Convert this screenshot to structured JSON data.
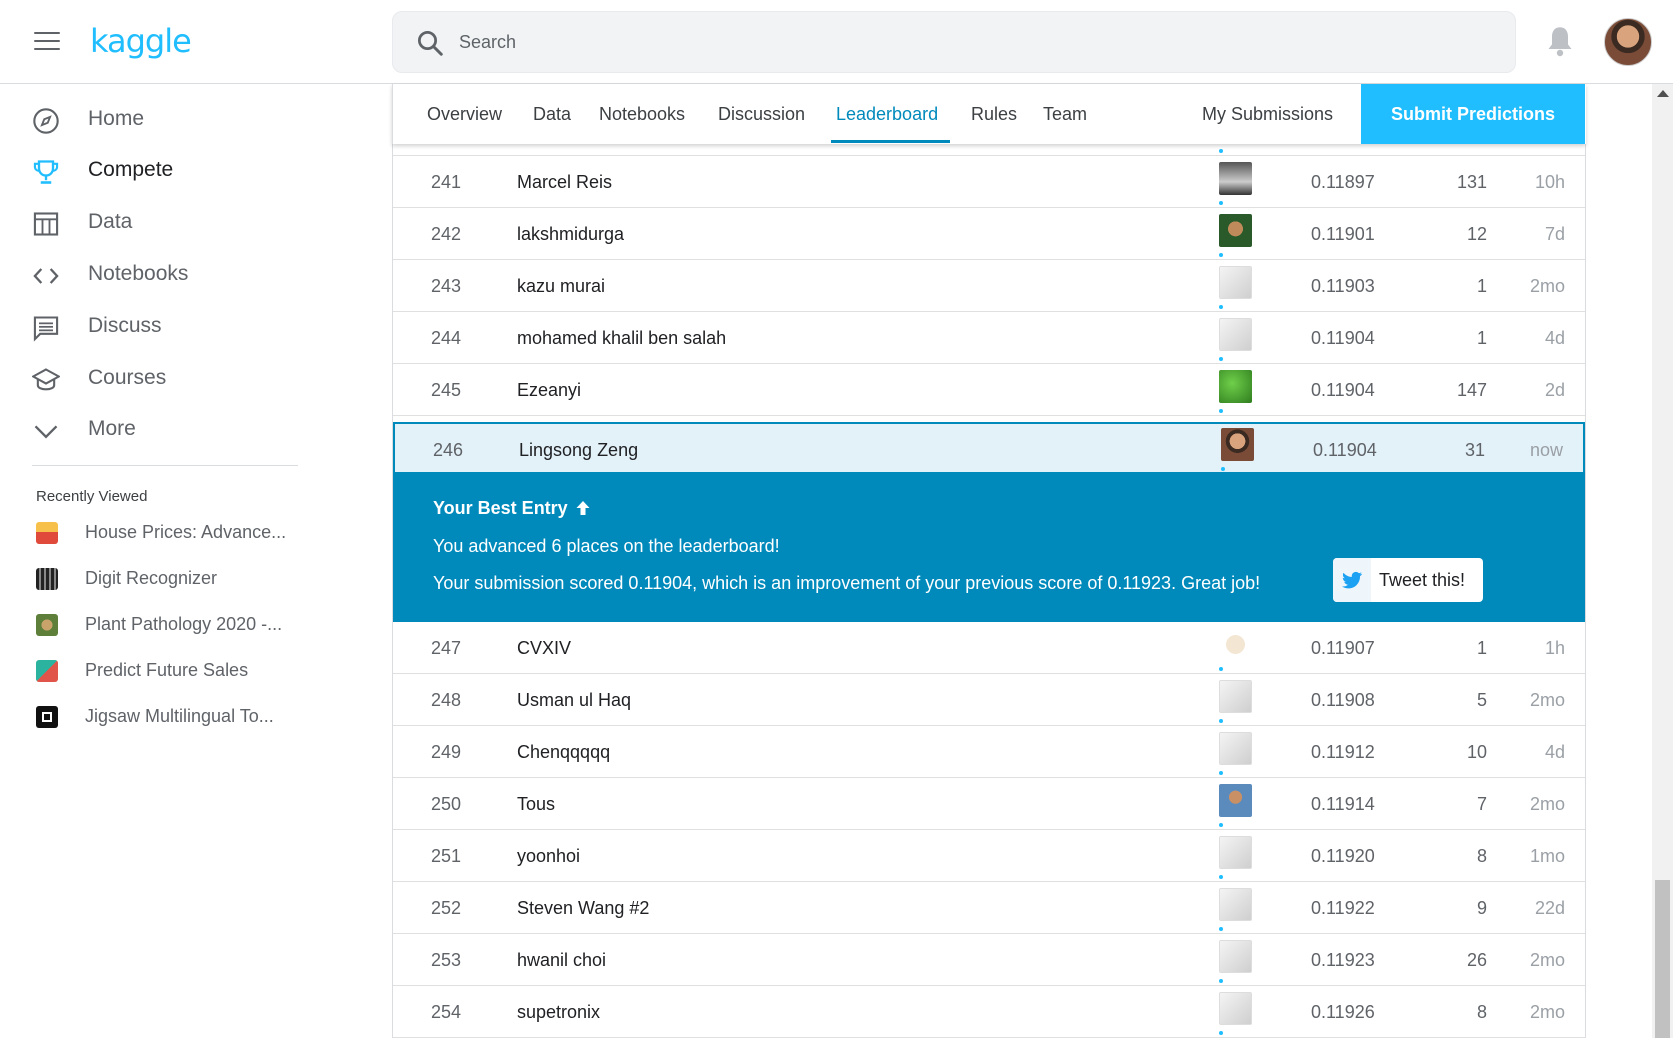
{
  "header": {
    "logo": "kaggle",
    "search_placeholder": "Search"
  },
  "sidebar": {
    "items": [
      {
        "label": "Home",
        "icon": "compass-icon"
      },
      {
        "label": "Compete",
        "icon": "trophy-icon",
        "active": true
      },
      {
        "label": "Data",
        "icon": "table-icon"
      },
      {
        "label": "Notebooks",
        "icon": "code-icon"
      },
      {
        "label": "Discuss",
        "icon": "comment-icon"
      },
      {
        "label": "Courses",
        "icon": "school-icon"
      },
      {
        "label": "More",
        "icon": "chevron-down-icon"
      }
    ],
    "recently_viewed_title": "Recently Viewed",
    "recently_viewed": [
      {
        "label": "House Prices: Advance..."
      },
      {
        "label": "Digit Recognizer"
      },
      {
        "label": "Plant Pathology 2020 -..."
      },
      {
        "label": "Predict Future Sales"
      },
      {
        "label": "Jigsaw Multilingual To..."
      }
    ]
  },
  "tabs": {
    "items": [
      "Overview",
      "Data",
      "Notebooks",
      "Discussion",
      "Leaderboard",
      "Rules",
      "Team"
    ],
    "active": "Leaderboard",
    "my_submissions": "My Submissions",
    "submit": "Submit Predictions"
  },
  "leaderboard": {
    "rows_top": [
      {
        "rank": "241",
        "name": "Marcel Reis",
        "score": "0.11897",
        "entries": "131",
        "last": "10h"
      },
      {
        "rank": "242",
        "name": "lakshmidurga",
        "score": "0.11901",
        "entries": "12",
        "last": "7d"
      },
      {
        "rank": "243",
        "name": "kazu murai",
        "score": "0.11903",
        "entries": "1",
        "last": "2mo"
      },
      {
        "rank": "244",
        "name": "mohamed khalil ben salah",
        "score": "0.11904",
        "entries": "1",
        "last": "4d"
      },
      {
        "rank": "245",
        "name": "Ezeanyi",
        "score": "0.11904",
        "entries": "147",
        "last": "2d"
      }
    ],
    "my_row": {
      "rank": "246",
      "name": "Lingsong Zeng",
      "score": "0.11904",
      "entries": "31",
      "last": "now"
    },
    "rows_bottom": [
      {
        "rank": "247",
        "name": "CVXIV",
        "score": "0.11907",
        "entries": "1",
        "last": "1h"
      },
      {
        "rank": "248",
        "name": "Usman ul Haq",
        "score": "0.11908",
        "entries": "5",
        "last": "2mo"
      },
      {
        "rank": "249",
        "name": "Chenqqqqq",
        "score": "0.11912",
        "entries": "10",
        "last": "4d"
      },
      {
        "rank": "250",
        "name": "Tous",
        "score": "0.11914",
        "entries": "7",
        "last": "2mo"
      },
      {
        "rank": "251",
        "name": "yoonhoi",
        "score": "0.11920",
        "entries": "8",
        "last": "1mo"
      },
      {
        "rank": "252",
        "name": "Steven Wang #2",
        "score": "0.11922",
        "entries": "9",
        "last": "22d"
      },
      {
        "rank": "253",
        "name": "hwanil choi",
        "score": "0.11923",
        "entries": "26",
        "last": "2mo"
      },
      {
        "rank": "254",
        "name": "supetronix",
        "score": "0.11926",
        "entries": "8",
        "last": "2mo"
      }
    ]
  },
  "banner": {
    "title": "Your Best Entry",
    "advanced": "You advanced 6 places on the leaderboard!",
    "scored": "Your submission scored 0.11904, which is an improvement of your previous score of 0.11923. Great job!",
    "tweet": "Tweet this!"
  },
  "colors": {
    "accent": "#20beff",
    "active_tab": "#008abc",
    "banner": "#008abc",
    "my_row_bg": "#e3f1f8"
  }
}
